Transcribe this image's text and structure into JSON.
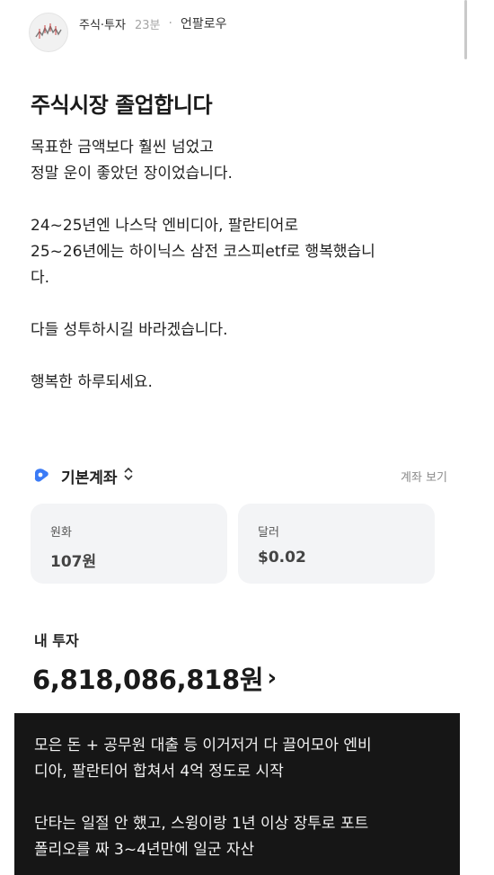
{
  "header": {
    "channel": "주식·투자",
    "time": "23분",
    "separator": "·",
    "follow_label": "언팔로우"
  },
  "post": {
    "title": "주식시장 졸업합니다",
    "paragraphs": [
      "목표한 금액보다 훨씬 넘었고\n정말 운이 좋았던 장이었습니다.",
      "24~25년엔 나스닥 엔비디아, 팔란티어로\n25~26년에는 하이닉스 삼전 코스피etf로 행복했습니\n다.",
      "다들 성투하시길 바라겠습니다.",
      "행복한 하루되세요."
    ]
  },
  "account": {
    "name": "기본계좌",
    "toggle_icon": "⌃⌄",
    "view_link": "계좌 보기",
    "accent_color": "#3b7bf6",
    "cards": [
      {
        "label": "원화",
        "value": "107원"
      },
      {
        "label": "달러",
        "value": "$0.02"
      }
    ]
  },
  "investment": {
    "label": "내 투자",
    "amount": "6,818,086,818원",
    "arrow": "›"
  },
  "caption": {
    "paragraphs": [
      "모은 돈 + 공무원 대출 등 이거저거 다 끌어모아 엔비\n디아, 팔란티어 합쳐서 4억 정도로 시작",
      "단타는 일절 안 했고, 스윙이랑 1년 이상 장투로 포트\n폴리오를 짜 3~4년만에 일군 자산"
    ]
  }
}
